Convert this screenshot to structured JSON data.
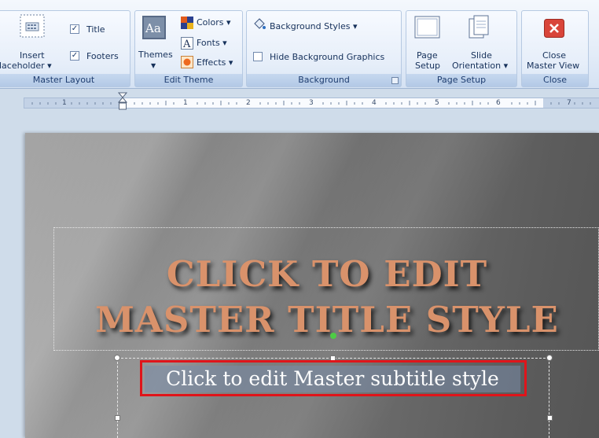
{
  "ribbon": {
    "master_layout": {
      "insert_placeholder_line1": "Insert",
      "insert_placeholder_line2": "laceholder ▾",
      "title_check": "Title",
      "footers_check": "Footers",
      "caption": "Master Layout"
    },
    "edit_theme": {
      "themes_label": "Themes",
      "colors_label": "Colors ▾",
      "fonts_label": "Fonts ▾",
      "effects_label": "Effects ▾",
      "caption": "Edit Theme"
    },
    "background": {
      "styles_label": "Background Styles ▾",
      "hide_graphics_label": "Hide Background Graphics",
      "caption": "Background"
    },
    "page_setup": {
      "page_setup_line1": "Page",
      "page_setup_line2": "Setup",
      "orientation_line1": "Slide",
      "orientation_line2": "Orientation ▾",
      "caption": "Page Setup"
    },
    "close": {
      "close_line1": "Close",
      "close_line2": "Master View",
      "caption": "Close"
    }
  },
  "ruler": {
    "labels": [
      "1",
      "1",
      "2",
      "3",
      "4",
      "5",
      "6",
      "7"
    ]
  },
  "slide": {
    "title_line1": "CLICK TO EDIT",
    "title_line2": "MASTER TITLE STYLE",
    "subtitle": "Click to edit Master subtitle style"
  },
  "colors": {
    "title": "#d9926b",
    "highlight_frame": "#e0141a",
    "ribbon_caption": "#1e3d70"
  },
  "icons": {
    "insert_placeholder": "placeholder-icon",
    "themes": "themes-icon",
    "colors": "colors-icon",
    "fonts": "fonts-icon",
    "effects": "effects-icon",
    "background_styles": "paint-bucket-icon",
    "page_setup": "page-setup-icon",
    "slide_orientation": "orientation-icon",
    "close_master_view": "close-icon"
  }
}
